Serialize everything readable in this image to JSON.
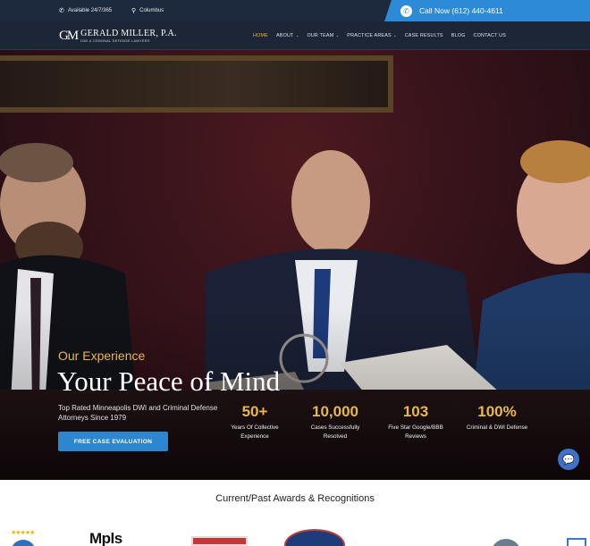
{
  "topbar": {
    "availability": "Available 24/7/365",
    "location": "Columbus",
    "call_label": "Call Now (612) 440-4611"
  },
  "logo": {
    "monogram": "GM",
    "name": "GERALD MILLER, P.A.",
    "subtitle": "DWI & CRIMINAL DEFENSE LAWYERS"
  },
  "nav": {
    "items": [
      {
        "label": "HOME",
        "active": true,
        "dropdown": false
      },
      {
        "label": "ABOUT",
        "active": false,
        "dropdown": true
      },
      {
        "label": "OUR TEAM",
        "active": false,
        "dropdown": true
      },
      {
        "label": "PRACTICE AREAS",
        "active": false,
        "dropdown": true
      },
      {
        "label": "CASE RESULTS",
        "active": false,
        "dropdown": false
      },
      {
        "label": "BLOG",
        "active": false,
        "dropdown": false
      },
      {
        "label": "CONTACT US",
        "active": false,
        "dropdown": false
      }
    ]
  },
  "hero": {
    "eyebrow": "Our Experience",
    "headline": "Your Peace of Mind",
    "tagline": "Top Rated Minneapolis DWI and Criminal Defense Attorneys Since 1979",
    "cta_label": "FREE CASE EVALUATION",
    "stats": [
      {
        "value": "50+",
        "label": "Years Of Collective Experience"
      },
      {
        "value": "10,000",
        "label": "Cases Successfully Resolved"
      },
      {
        "value": "103",
        "label": "Five Star Google/BBB Reviews"
      },
      {
        "value": "100%",
        "label": "Criminal & DWI Defense"
      }
    ]
  },
  "awards": {
    "title": "Current/Past Awards & Recognitions",
    "mpls_text": "Mpls",
    "stars": "★★★★★"
  },
  "colors": {
    "topbar_bg": "#1d2a3d",
    "accent_blue": "#2d8ad6",
    "gold": "#e8b84a"
  },
  "icons": {
    "phone": "phone-icon",
    "pin": "location-pin-icon",
    "chat": "chat-icon"
  }
}
